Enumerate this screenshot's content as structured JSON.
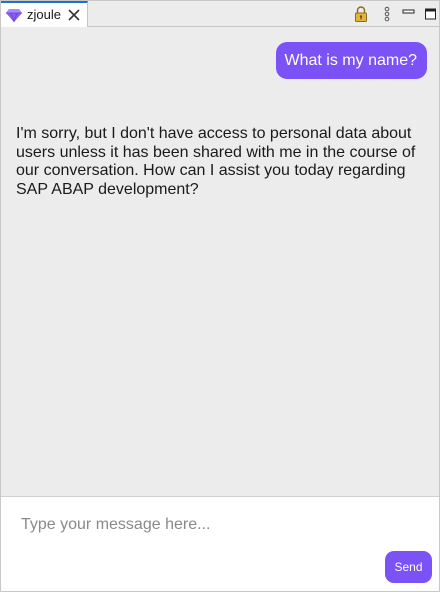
{
  "tab": {
    "label": "zjoule",
    "icon": "diamond-icon",
    "close_icon": "close-icon"
  },
  "view_actions": [
    {
      "icon": "lock-icon"
    },
    {
      "icon": "kebab-menu-icon"
    },
    {
      "icon": "minimize-icon"
    },
    {
      "icon": "maximize-icon"
    }
  ],
  "chat": {
    "messages": [
      {
        "role": "user",
        "text": "What is my name?"
      },
      {
        "role": "assistant",
        "text": "I'm sorry, but I don't have access to personal data about users unless it has been shared with me in the course of our conversation. How can I assist you today regarding SAP ABAP development?"
      }
    ]
  },
  "composer": {
    "placeholder": "Type your message here...",
    "value": "",
    "send_label": "Send"
  },
  "colors": {
    "accent": "#7b52f5",
    "chat_background": "#ececec"
  }
}
